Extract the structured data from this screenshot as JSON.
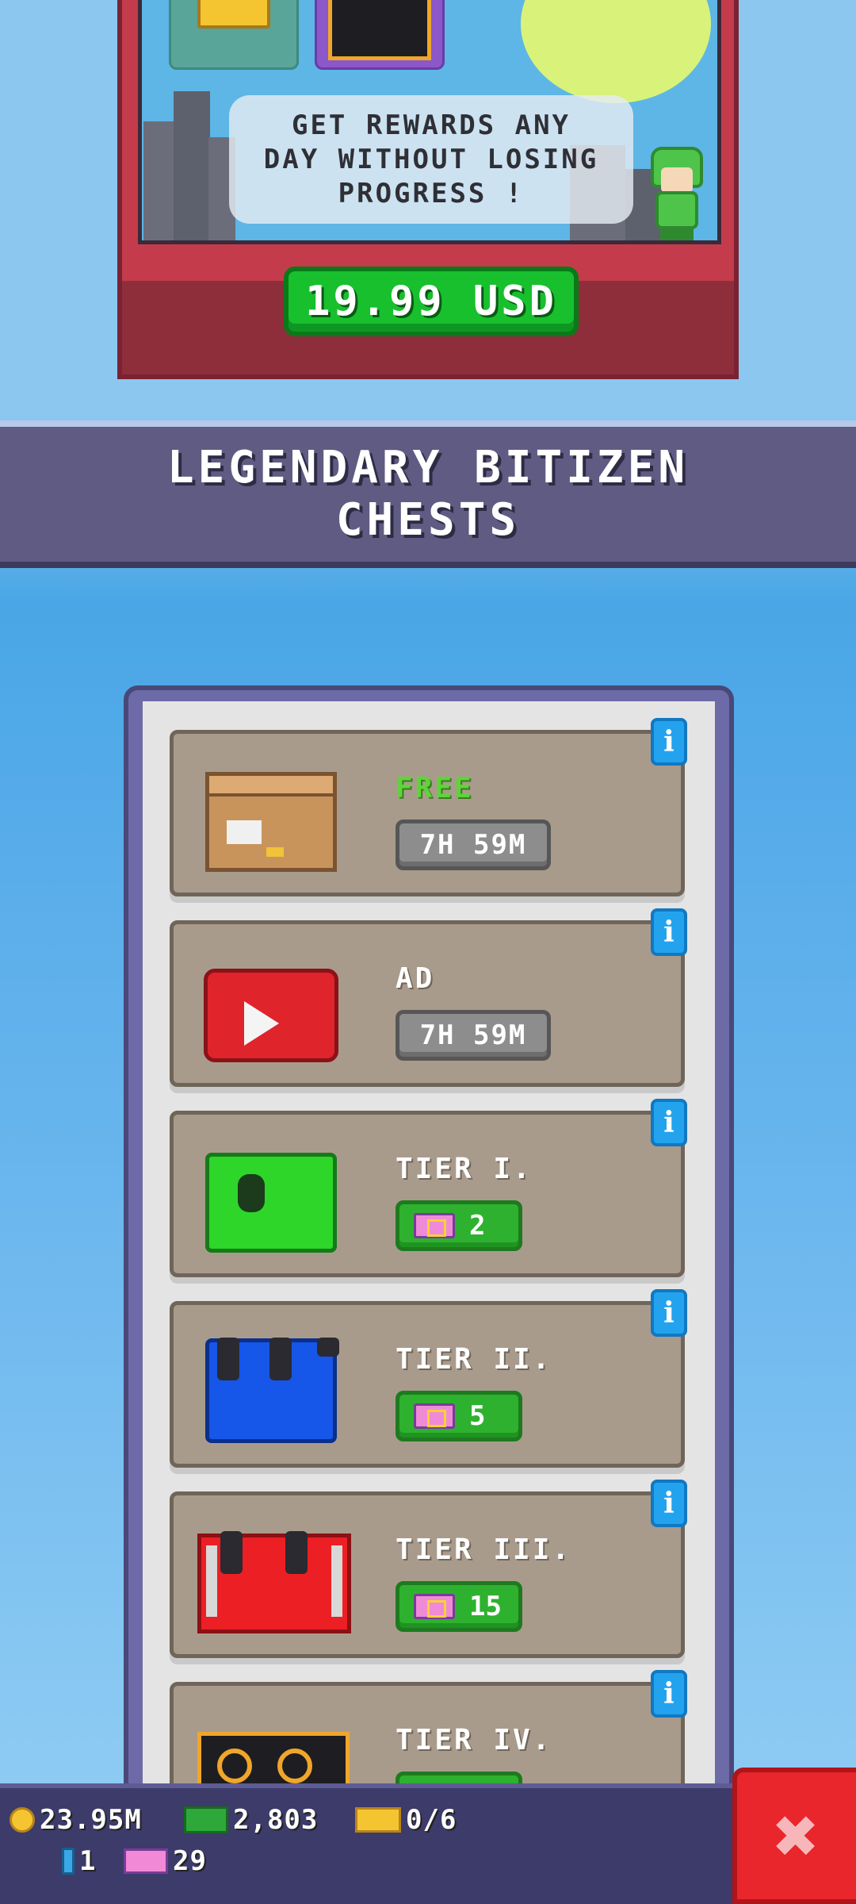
{
  "pass": {
    "message": "GET REWARDS ANY\nDAY WITHOUT LOSING\nPROGRESS !",
    "price": "19.99 USD"
  },
  "section": {
    "title": "LEGENDARY BITIZEN\nCHESTS"
  },
  "chests": [
    {
      "label": "FREE",
      "timer": "7H 59M",
      "icon": "wooden-crate"
    },
    {
      "label": "AD",
      "timer": "7H 59M",
      "icon": "red-ad-chest"
    },
    {
      "label": "TIER I.",
      "cost": "2",
      "icon": "green-chest"
    },
    {
      "label": "TIER II.",
      "cost": "5",
      "icon": "blue-chest"
    },
    {
      "label": "TIER III.",
      "cost": "15",
      "icon": "red-chest"
    },
    {
      "label": "TIER IV.",
      "icon": "black-gold-chest"
    }
  ],
  "info_symbol": "i",
  "status": {
    "coins": "23.95M",
    "bux": "2,803",
    "gold_tickets": "0/6",
    "elevator_pass": "1",
    "tickets": "29"
  },
  "close_symbol": "✖",
  "colors": {
    "accent_green": "#2eb12f",
    "header_purple": "#5f5b82",
    "close_red": "#e8262b",
    "info_blue": "#23a3ee"
  }
}
